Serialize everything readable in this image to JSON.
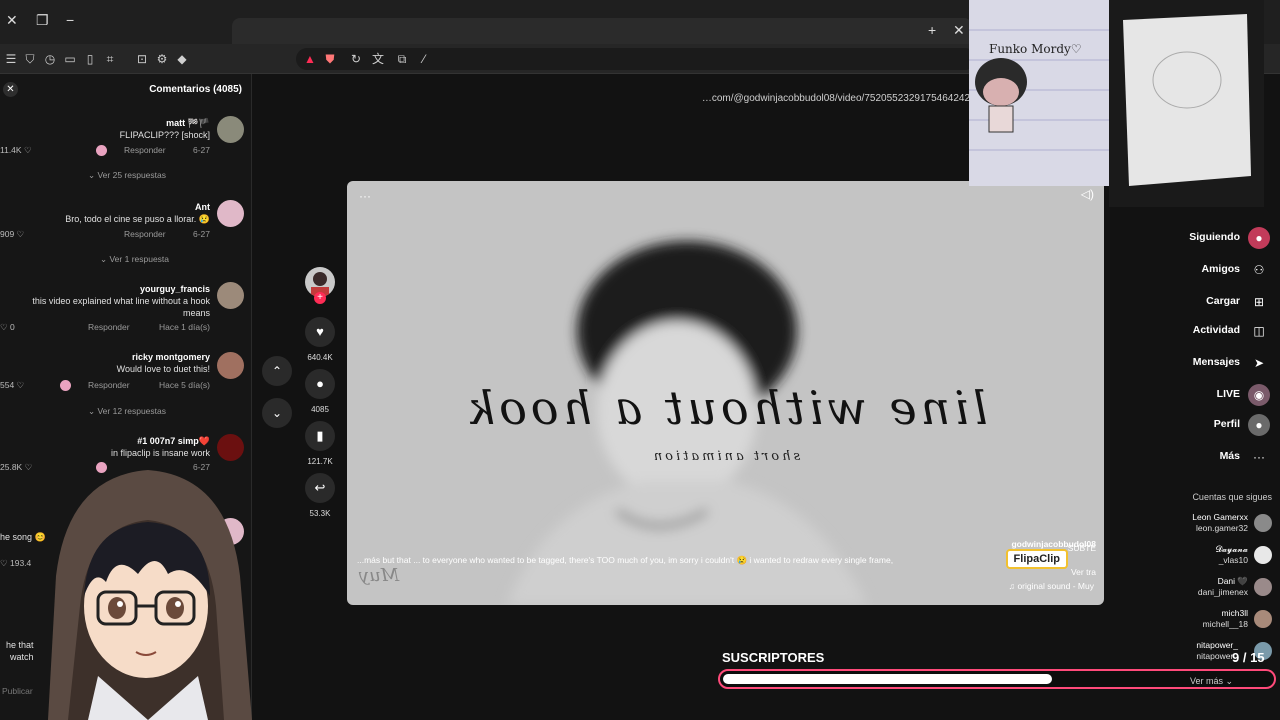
{
  "browser": {
    "url": "…com/@godwinjacobbudol08/video/7520552329175464242"
  },
  "comments_panel": {
    "title": "Comentarios (4085)",
    "publish_placeholder": "Publicar",
    "comments": [
      {
        "user": "matt 🏁🏴",
        "text": "FLIPACLIP??? [shock]",
        "date": "6-27",
        "reply": "Responder",
        "likes": "11.4K",
        "view_replies": "Ver 25 respuestas"
      },
      {
        "user": "Ant",
        "text": "Bro, todo el cine se puso a llorar. 😢",
        "date": "6-27",
        "reply": "Responder",
        "likes": "909",
        "view_replies": "Ver 1 respuesta"
      },
      {
        "user": "yourguy_francis",
        "text": "this video explained what line without a hook",
        "text2": "means",
        "date": "Hace 1 día(s)",
        "reply": "Responder",
        "likes": "0"
      },
      {
        "user": "ricky montgomery",
        "text": "Would love to duet this!",
        "date": "Hace 5 día(s)",
        "reply": "Responder",
        "likes": "554",
        "view_replies": "Ver 12 respuestas"
      },
      {
        "user": "#1 007n7 simp❤️",
        "text": "in flipaclip is insane work",
        "date": "6-27",
        "likes": "25.8K"
      },
      {
        "user": "",
        "text": "he song 😊",
        "likes": "193.4"
      },
      {
        "user": "",
        "text": "he that",
        "text2": "watch"
      }
    ]
  },
  "video": {
    "title_mirrored": "line without a hook",
    "subtitle_mirrored": "short animation",
    "author": "godwinjacobbudol08",
    "caption": "...más   but that ... to everyone who wanted to be tagged, there's TOO much of you, im sorry i couldn't 😢 i wanted to redraw every single frame,",
    "caption_prefix": "SUBTE",
    "see_translation": "Ver tra",
    "sound": "♫ original sound - Muy",
    "watermark": "Muy",
    "badge": "FlipaClip"
  },
  "actions": {
    "likes": "640.4K",
    "comments": "4085",
    "saves": "121.7K",
    "shares": "53.3K"
  },
  "photo_overlay": {
    "drawing_caption": "Funko Mordy♡"
  },
  "sidebar": {
    "nav": [
      {
        "label": "Siguiendo",
        "icon": "following-icon"
      },
      {
        "label": "Amigos",
        "icon": "friends-icon"
      },
      {
        "label": "Cargar",
        "icon": "upload-icon"
      },
      {
        "label": "Actividad",
        "icon": "activity-icon"
      },
      {
        "label": "Mensajes",
        "icon": "messages-icon"
      },
      {
        "label": "LIVE",
        "icon": "live-icon"
      },
      {
        "label": "Perfil",
        "icon": "profile-icon"
      },
      {
        "label": "Más",
        "icon": "more-icon"
      }
    ],
    "following_title": "Cuentas que sigues",
    "accounts": [
      {
        "name": "Leon Gamerxx",
        "handle": "leon.gamer32"
      },
      {
        "name": "𝓓𝓪𝔂𝓪𝓷𝓪",
        "handle": "_vlas10"
      },
      {
        "name": "Dani 🖤",
        "handle": "dani_jimenex"
      },
      {
        "name": "mich3ll",
        "handle": "michell__18"
      },
      {
        "name": "nitapower_",
        "handle": "nitapower_"
      }
    ],
    "see_more": "Ver más"
  },
  "subscriber_goal": {
    "label": "SUSCRIPTORES",
    "count": "9 / 15",
    "progress": 0.6
  },
  "colors": {
    "accent": "#fe2c55",
    "goal_border": "#ff4a7a"
  }
}
